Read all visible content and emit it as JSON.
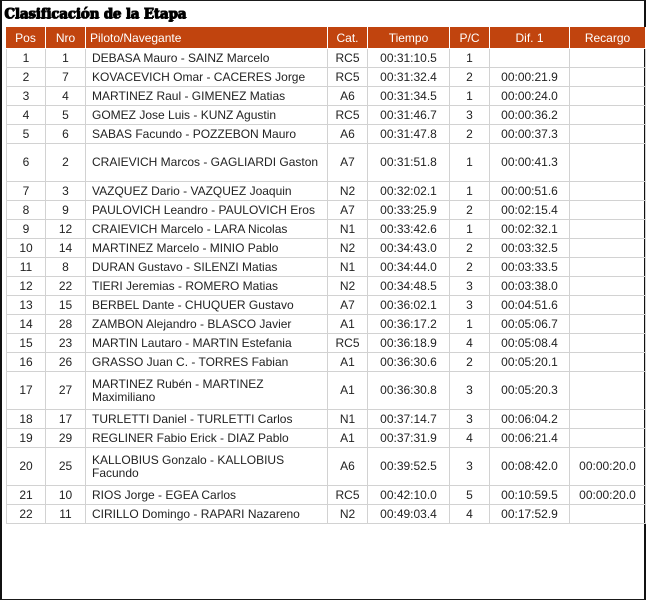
{
  "title": "Clasificación de la Etapa",
  "columns": [
    "Pos",
    "Nro",
    "Piloto/Navegante",
    "Cat.",
    "Tiempo",
    "P/C",
    "Dif. 1",
    "Recargo"
  ],
  "rows": [
    {
      "pos": "1",
      "nro": "1",
      "piloto": "DEBASA Mauro - SAINZ Marcelo",
      "cat": "RC5",
      "tiempo": "00:31:10.5",
      "pc": "1",
      "dif": "",
      "recargo": ""
    },
    {
      "pos": "2",
      "nro": "7",
      "piloto": "KOVACEVICH Omar - CACERES Jorge",
      "cat": "RC5",
      "tiempo": "00:31:32.4",
      "pc": "2",
      "dif": "00:00:21.9",
      "recargo": ""
    },
    {
      "pos": "3",
      "nro": "4",
      "piloto": "MARTINEZ Raul - GIMENEZ Matias",
      "cat": "A6",
      "tiempo": "00:31:34.5",
      "pc": "1",
      "dif": "00:00:24.0",
      "recargo": ""
    },
    {
      "pos": "4",
      "nro": "5",
      "piloto": "GOMEZ Jose Luis - KUNZ Agustin",
      "cat": "RC5",
      "tiempo": "00:31:46.7",
      "pc": "3",
      "dif": "00:00:36.2",
      "recargo": ""
    },
    {
      "pos": "5",
      "nro": "6",
      "piloto": "SABAS Facundo - POZZEBON Mauro",
      "cat": "A6",
      "tiempo": "00:31:47.8",
      "pc": "2",
      "dif": "00:00:37.3",
      "recargo": ""
    },
    {
      "pos": "6",
      "nro": "2",
      "piloto": "CRAIEVICH Marcos - GAGLIARDI Gaston",
      "cat": "A7",
      "tiempo": "00:31:51.8",
      "pc": "1",
      "dif": "00:00:41.3",
      "recargo": ""
    },
    {
      "pos": "7",
      "nro": "3",
      "piloto": "VAZQUEZ Dario - VAZQUEZ Joaquin",
      "cat": "N2",
      "tiempo": "00:32:02.1",
      "pc": "1",
      "dif": "00:00:51.6",
      "recargo": ""
    },
    {
      "pos": "8",
      "nro": "9",
      "piloto": "PAULOVICH Leandro - PAULOVICH Eros",
      "cat": "A7",
      "tiempo": "00:33:25.9",
      "pc": "2",
      "dif": "00:02:15.4",
      "recargo": ""
    },
    {
      "pos": "9",
      "nro": "12",
      "piloto": "CRAIEVICH Marcelo - LARA Nicolas",
      "cat": "N1",
      "tiempo": "00:33:42.6",
      "pc": "1",
      "dif": "00:02:32.1",
      "recargo": ""
    },
    {
      "pos": "10",
      "nro": "14",
      "piloto": "MARTINEZ Marcelo - MINIO Pablo",
      "cat": "N2",
      "tiempo": "00:34:43.0",
      "pc": "2",
      "dif": "00:03:32.5",
      "recargo": ""
    },
    {
      "pos": "11",
      "nro": "8",
      "piloto": "DURAN Gustavo - SILENZI Matias",
      "cat": "N1",
      "tiempo": "00:34:44.0",
      "pc": "2",
      "dif": "00:03:33.5",
      "recargo": ""
    },
    {
      "pos": "12",
      "nro": "22",
      "piloto": "TIERI Jeremias - ROMERO Matias",
      "cat": "N2",
      "tiempo": "00:34:48.5",
      "pc": "3",
      "dif": "00:03:38.0",
      "recargo": ""
    },
    {
      "pos": "13",
      "nro": "15",
      "piloto": "BERBEL Dante - CHUQUER Gustavo",
      "cat": "A7",
      "tiempo": "00:36:02.1",
      "pc": "3",
      "dif": "00:04:51.6",
      "recargo": ""
    },
    {
      "pos": "14",
      "nro": "28",
      "piloto": "ZAMBON Alejandro - BLASCO Javier",
      "cat": "A1",
      "tiempo": "00:36:17.2",
      "pc": "1",
      "dif": "00:05:06.7",
      "recargo": ""
    },
    {
      "pos": "15",
      "nro": "23",
      "piloto": "MARTIN Lautaro - MARTIN Estefania",
      "cat": "RC5",
      "tiempo": "00:36:18.9",
      "pc": "4",
      "dif": "00:05:08.4",
      "recargo": ""
    },
    {
      "pos": "16",
      "nro": "26",
      "piloto": "GRASSO Juan C. - TORRES Fabian",
      "cat": "A1",
      "tiempo": "00:36:30.6",
      "pc": "2",
      "dif": "00:05:20.1",
      "recargo": ""
    },
    {
      "pos": "17",
      "nro": "27",
      "piloto": "MARTINEZ Rubén - MARTINEZ Maximiliano",
      "cat": "A1",
      "tiempo": "00:36:30.8",
      "pc": "3",
      "dif": "00:05:20.3",
      "recargo": ""
    },
    {
      "pos": "18",
      "nro": "17",
      "piloto": "TURLETTI Daniel - TURLETTI Carlos",
      "cat": "N1",
      "tiempo": "00:37:14.7",
      "pc": "3",
      "dif": "00:06:04.2",
      "recargo": ""
    },
    {
      "pos": "19",
      "nro": "29",
      "piloto": "REGLINER Fabio Erick - DIAZ Pablo",
      "cat": "A1",
      "tiempo": "00:37:31.9",
      "pc": "4",
      "dif": "00:06:21.4",
      "recargo": ""
    },
    {
      "pos": "20",
      "nro": "25",
      "piloto": "KALLOBIUS Gonzalo - KALLOBIUS Facundo",
      "cat": "A6",
      "tiempo": "00:39:52.5",
      "pc": "3",
      "dif": "00:08:42.0",
      "recargo": "00:00:20.0"
    },
    {
      "pos": "21",
      "nro": "10",
      "piloto": "RIOS Jorge - EGEA Carlos",
      "cat": "RC5",
      "tiempo": "00:42:10.0",
      "pc": "5",
      "dif": "00:10:59.5",
      "recargo": "00:00:20.0"
    },
    {
      "pos": "22",
      "nro": "11",
      "piloto": "CIRILLO Domingo - RAPARI Nazareno",
      "cat": "N2",
      "tiempo": "00:49:03.4",
      "pc": "4",
      "dif": "00:17:52.9",
      "recargo": ""
    }
  ]
}
